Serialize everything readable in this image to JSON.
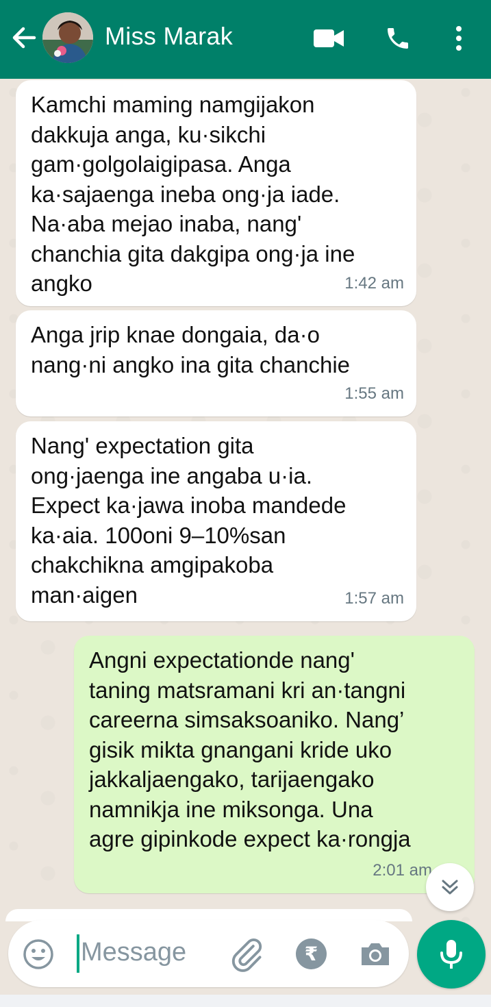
{
  "header": {
    "contact_name": "Miss Marak",
    "colors": {
      "bar": "#008069",
      "accent": "#00a884"
    },
    "icons": [
      "arrow-back-icon",
      "video-call-icon",
      "phone-icon",
      "more-vert-icon"
    ]
  },
  "messages": [
    {
      "direction": "incoming",
      "text": "Kamchi maming namgijakon\ndakkuja anga, ku·sikchi\ngam·golgolaigipasa. Anga\nka·sajaenga ineba ong·ja iade.\nNa·aba mejao inaba, nang'\nchanchia gita dakgipa ong·ja ine\nangko",
      "time": "1:42 am"
    },
    {
      "direction": "incoming",
      "text": "Anga jrip knae dongaia, da·o\nnang·ni angko ina gita chanchie",
      "time": "1:55 am"
    },
    {
      "direction": "incoming",
      "text": "Nang' expectation gita\nong·jaenga ine angaba u·ia.\nExpect ka·jawa inoba mandede\nka·aia. 100oni 9–10%san\nchakchikna amgipakoba\nman·aigen",
      "time": "1:57 am"
    },
    {
      "direction": "outgoing",
      "text": "Angni expectationde nang'\ntaning matsramani kri an·tangni\ncareerna simsaksoaniko. Nang’\ngisik mikta gnangani kride uko\njakkaljaengako, tarijaengako\nnamnikja ine miksonga. Una\nagre gipinkode expect ka·rongja",
      "time": "2:01 am"
    }
  ],
  "composer": {
    "placeholder": "Message",
    "rupee_symbol": "₹",
    "icons": [
      "emoji-icon",
      "attach-icon",
      "rupee-icon",
      "camera-icon",
      "mic-icon",
      "scroll-down-icon"
    ]
  }
}
